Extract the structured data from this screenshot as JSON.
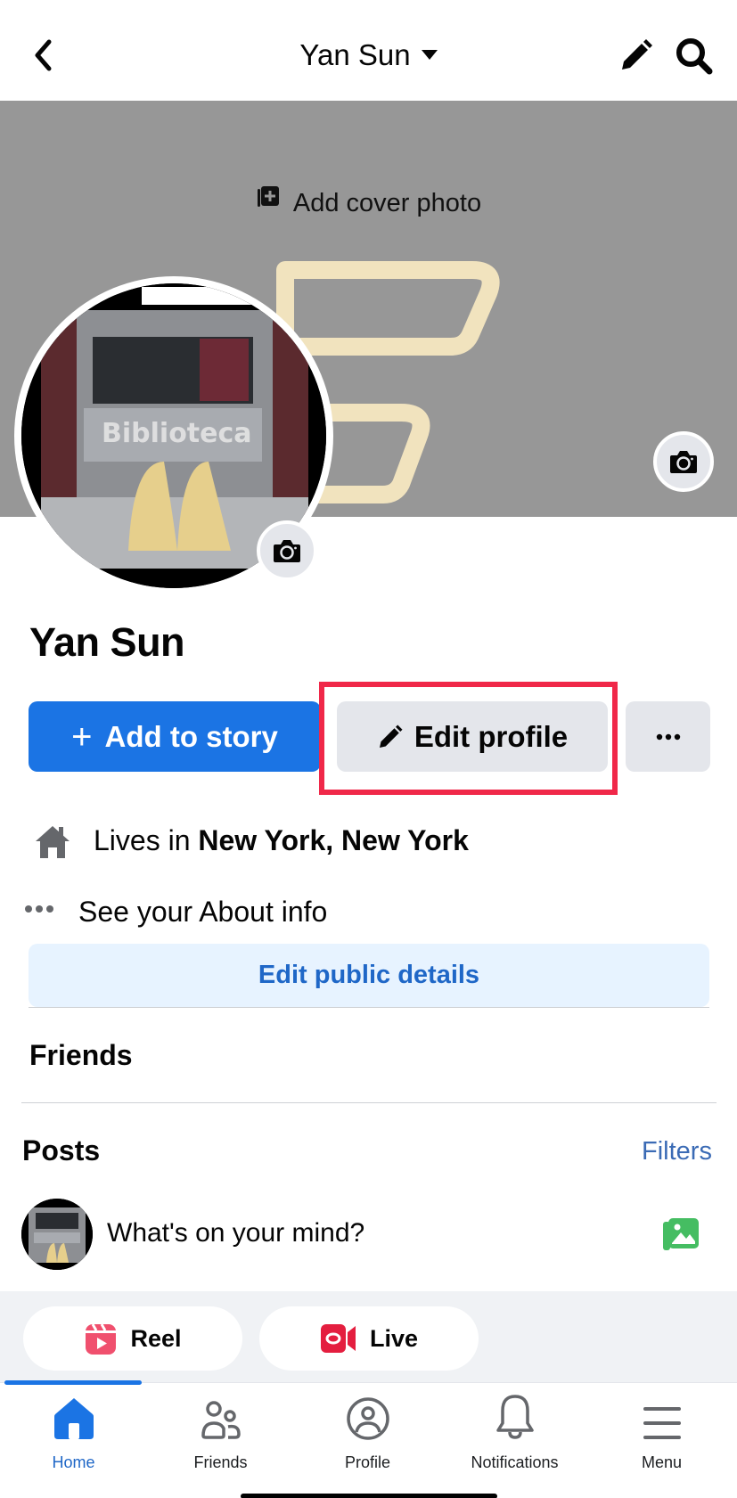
{
  "header": {
    "title": "Yan Sun",
    "back_icon": "chevron-left-icon",
    "edit_icon": "pencil-icon",
    "search_icon": "search-icon"
  },
  "cover": {
    "add_cover_label": "Add cover photo",
    "background_color": "#979797"
  },
  "profile": {
    "name": "Yan Sun",
    "add_story_label": "Add to story",
    "edit_profile_label": "Edit profile",
    "more_label": "···",
    "highlight_color": "#f02849"
  },
  "details": {
    "lives_prefix": "Lives in",
    "lives_location": "New York, New York",
    "about_label": "See your About info",
    "edit_public_label": "Edit public details"
  },
  "friends": {
    "heading": "Friends"
  },
  "posts": {
    "heading": "Posts",
    "filters_label": "Filters",
    "composer_placeholder": "What's on your mind?",
    "reel_label": "Reel",
    "live_label": "Live"
  },
  "nav": {
    "items": [
      {
        "label": "Home",
        "icon": "home-icon",
        "active": true
      },
      {
        "label": "Friends",
        "icon": "friends-icon",
        "active": false
      },
      {
        "label": "Profile",
        "icon": "profile-icon",
        "active": false
      },
      {
        "label": "Notifications",
        "icon": "bell-icon",
        "active": false
      },
      {
        "label": "Menu",
        "icon": "menu-icon",
        "active": false
      }
    ]
  },
  "colors": {
    "brand_blue": "#1b74e4",
    "link_blue": "#1f67c7",
    "light_blue_bg": "#e7f3ff",
    "secondary_btn": "#e4e6eb"
  }
}
